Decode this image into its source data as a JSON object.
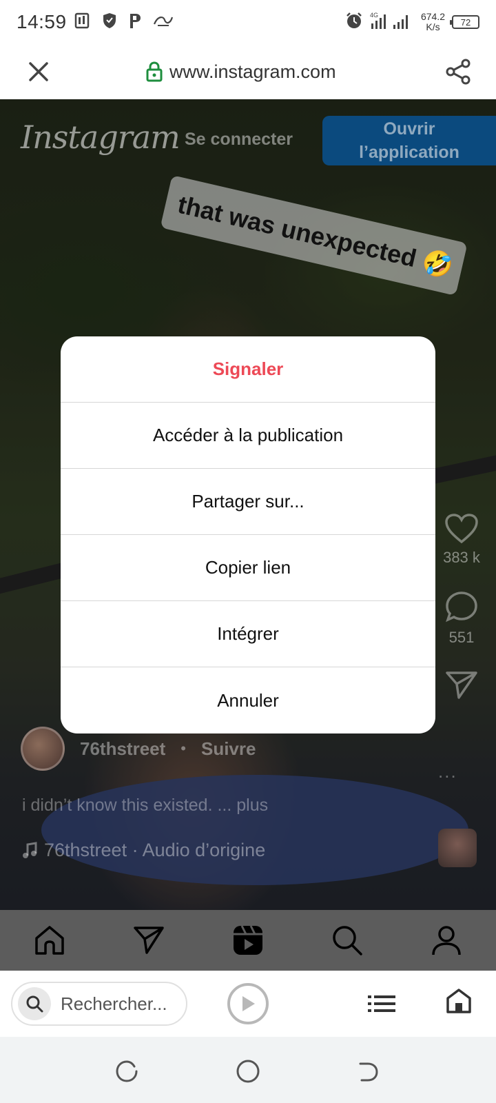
{
  "status_bar": {
    "time": "14:59",
    "net_speed_value": "674.2",
    "net_speed_unit": "K/s",
    "network_type": "4G",
    "battery": "72",
    "icons": [
      "sim-icon",
      "shield-icon",
      "p-app-icon",
      "link-app-icon",
      "alarm-icon",
      "signal-icon"
    ]
  },
  "browser": {
    "url": "www.instagram.com",
    "close_icon": "close-icon",
    "secure_icon": "lock-icon",
    "share_icon": "share-icon"
  },
  "instagram": {
    "logo": "Instagram",
    "login_label": "Se connecter",
    "open_app_line1": "Ouvrir",
    "open_app_line2": "l’application",
    "sticker_text": "that was unexpected 🤣",
    "likes": "383 k",
    "comments": "551",
    "author": "76thstreet",
    "separator": "•",
    "follow_label": "Suivre",
    "caption": "i didn’t know this existed. ... plus",
    "audio": "76thstreet · Audio d’origine",
    "more": "..."
  },
  "ig_nav": {
    "items": [
      "home-icon",
      "direct-icon",
      "reels-icon",
      "search-icon",
      "profile-icon"
    ]
  },
  "modal": {
    "items": [
      {
        "label": "Signaler",
        "style": "danger"
      },
      {
        "label": "Accéder à la publication"
      },
      {
        "label": "Partager sur..."
      },
      {
        "label": "Copier lien"
      },
      {
        "label": "Intégrer"
      },
      {
        "label": "Annuler"
      }
    ]
  },
  "toolbar": {
    "search_placeholder": "Rechercher...",
    "icons": [
      "search-icon",
      "play-icon",
      "menu-icon",
      "home-icon"
    ]
  },
  "system_nav": {
    "icons": [
      "recents-icon",
      "home-circle-icon",
      "back-icon"
    ]
  },
  "colors": {
    "danger": "#ed4956",
    "open_app_bg": "#0b4a7e",
    "ig_nav_bg": "#5c5c5c",
    "system_nav_bg": "#f1f3f4"
  }
}
